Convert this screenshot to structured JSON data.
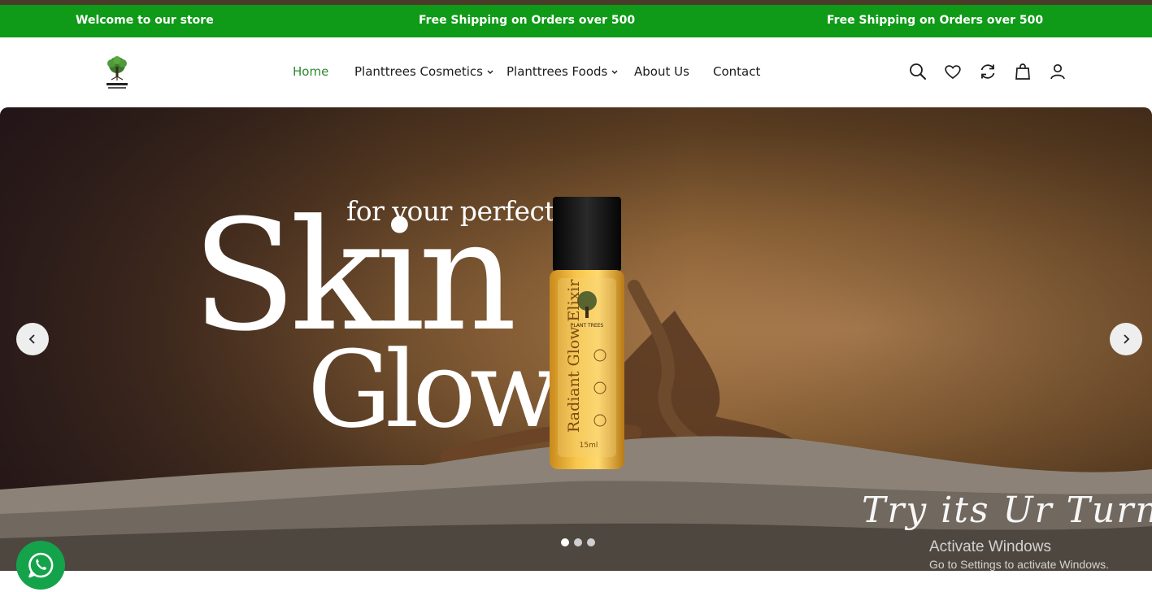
{
  "announcement": {
    "items": [
      "Welcome to our store",
      "Free Shipping on Orders over 500",
      "Free Shipping on Orders over 500"
    ],
    "background": "#0f9a17"
  },
  "header": {
    "logo_text": "PLANT TREES",
    "nav": [
      {
        "label": "Home",
        "active": true
      },
      {
        "label": "Planttrees Cosmetics",
        "dropdown": true
      },
      {
        "label": "Planttrees Foods",
        "dropdown": true
      },
      {
        "label": "About Us"
      },
      {
        "label": "Contact"
      }
    ],
    "icons": [
      "search-icon",
      "wishlist-heart-icon",
      "compare-refresh-icon",
      "cart-bag-icon",
      "account-user-icon"
    ],
    "accent_color": "#2f8a2f"
  },
  "hero": {
    "tagline_small": "for your perfect",
    "headline_1": "Skin",
    "headline_2": "Glow",
    "bottle_brand": "PLANT TREES",
    "bottle_name": "Radiant Glow Elixir",
    "bottle_volume": "15ml",
    "script_tag": "Try its Ur Turn",
    "slides_total": 3,
    "active_slide": 1
  },
  "windows_watermark": {
    "title": "Activate Windows",
    "subtitle": "Go to Settings to activate Windows."
  },
  "whatsapp": {
    "icon": "whatsapp-icon",
    "color": "#14a34a"
  }
}
